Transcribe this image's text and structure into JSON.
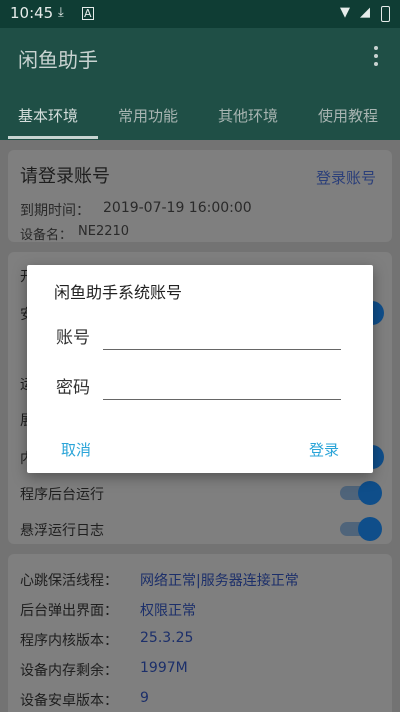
{
  "status_bar": {
    "time": "10:45",
    "icons": [
      "download-icon",
      "font-icon",
      "wifi-icon",
      "signal-icon",
      "battery-icon"
    ]
  },
  "app_bar": {
    "title": "闲鱼助手",
    "menu_icon": "more-vert-icon"
  },
  "tabs": [
    {
      "label": "基本环境",
      "active": true
    },
    {
      "label": "常用功能",
      "active": false
    },
    {
      "label": "其他环境",
      "active": false
    },
    {
      "label": "使用教程",
      "active": false
    }
  ],
  "login_card": {
    "title": "请登录账号",
    "login_link": "登录账号",
    "expire_label": "到期时间：",
    "expire_value": "2019-07-19 16:00:00",
    "device_label": "设备名：",
    "device_value": "NE2210"
  },
  "settings": {
    "visible_fragments": [
      "开",
      "安",
      "运",
      "展",
      "内"
    ],
    "rows": [
      {
        "label": "程序后台运行",
        "on": true
      },
      {
        "label": "悬浮运行日志",
        "on": true
      }
    ]
  },
  "info": [
    {
      "label": "心跳保活线程：",
      "value": "网络正常|服务器连接正常"
    },
    {
      "label": "后台弹出界面：",
      "value": "权限正常"
    },
    {
      "label": "程序内核版本：",
      "value": "25.3.25"
    },
    {
      "label": "设备内存剩余：",
      "value": "1997M"
    },
    {
      "label": "设备安卓版本：",
      "value": "9"
    }
  ],
  "dialog": {
    "title": "闲鱼助手系统账号",
    "account_label": "账号",
    "account_value": "",
    "password_label": "密码",
    "password_value": "",
    "cancel": "取消",
    "login": "登录"
  },
  "colors": {
    "status_bar": "#0f3d34",
    "app_bar": "#1f4f46",
    "accent": "#2aa4d8",
    "toggle_on": "#0f4e8a"
  }
}
